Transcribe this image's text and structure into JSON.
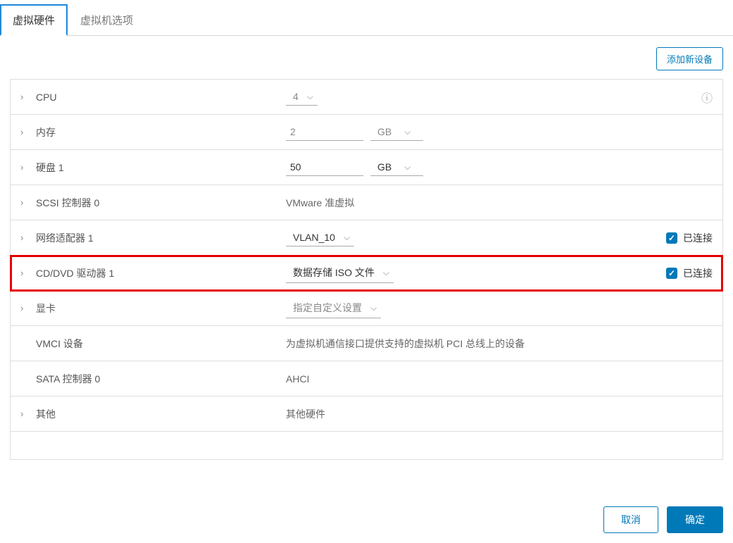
{
  "tabs": {
    "hardware": "虚拟硬件",
    "options": "虚拟机选项"
  },
  "toolbar": {
    "add_device": "添加新设备"
  },
  "rows": {
    "cpu": {
      "label": "CPU",
      "value": "4"
    },
    "memory": {
      "label": "内存",
      "value": "2",
      "unit": "GB"
    },
    "disk": {
      "label": "硬盘 1",
      "value": "50",
      "unit": "GB"
    },
    "scsi": {
      "label": "SCSI 控制器 0",
      "value": "VMware 准虚拟"
    },
    "nic": {
      "label": "网络适配器 1",
      "value": "VLAN_10",
      "connected": "已连接"
    },
    "cddvd": {
      "label": "CD/DVD 驱动器 1",
      "value": "数据存储 ISO 文件",
      "connected": "已连接"
    },
    "gpu": {
      "label": "显卡",
      "value": "指定自定义设置"
    },
    "vmci": {
      "label": "VMCI 设备",
      "value": "为虚拟机通信接口提供支持的虚拟机 PCI 总线上的设备"
    },
    "sata": {
      "label": "SATA 控制器 0",
      "value": "AHCI"
    },
    "other": {
      "label": "其他",
      "value": "其他硬件"
    }
  },
  "footer": {
    "cancel": "取消",
    "ok": "确定"
  }
}
